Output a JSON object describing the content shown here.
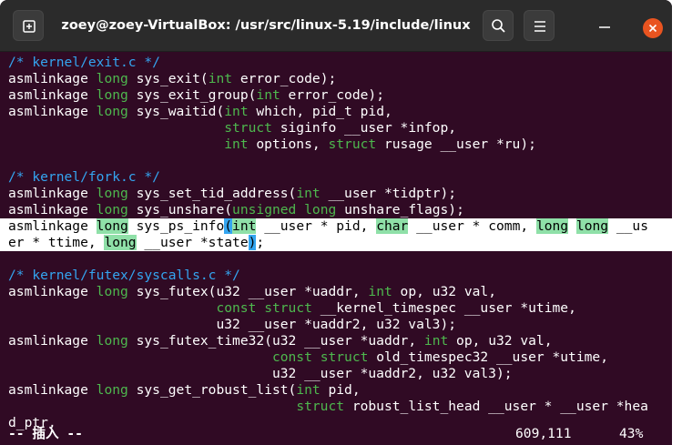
{
  "window": {
    "title": "zoey@zoey-VirtualBox: /usr/src/linux-5.19/include/linux",
    "accent": "#e95420",
    "background": "#300a24"
  },
  "lines": [
    [
      {
        "t": "/* kernel/exit.c */",
        "c": "c"
      }
    ],
    [
      {
        "t": "asmlinkage "
      },
      {
        "t": "long",
        "c": "k"
      },
      {
        "t": " sys_exit("
      },
      {
        "t": "int",
        "c": "k"
      },
      {
        "t": " error_code);"
      }
    ],
    [
      {
        "t": "asmlinkage "
      },
      {
        "t": "long",
        "c": "k"
      },
      {
        "t": " sys_exit_group("
      },
      {
        "t": "int",
        "c": "k"
      },
      {
        "t": " error_code);"
      }
    ],
    [
      {
        "t": "asmlinkage "
      },
      {
        "t": "long",
        "c": "k"
      },
      {
        "t": " sys_waitid("
      },
      {
        "t": "int",
        "c": "k"
      },
      {
        "t": " which, pid_t pid,"
      }
    ],
    [
      {
        "t": "                           "
      },
      {
        "t": "struct",
        "c": "k"
      },
      {
        "t": " siginfo __user *infop,"
      }
    ],
    [
      {
        "t": "                           "
      },
      {
        "t": "int",
        "c": "k"
      },
      {
        "t": " options, "
      },
      {
        "t": "struct",
        "c": "k"
      },
      {
        "t": " rusage __user *ru);"
      }
    ],
    [
      {
        "t": ""
      }
    ],
    [
      {
        "t": "/* kernel/fork.c */",
        "c": "c"
      }
    ],
    [
      {
        "t": "asmlinkage "
      },
      {
        "t": "long",
        "c": "k"
      },
      {
        "t": " sys_set_tid_address("
      },
      {
        "t": "int",
        "c": "k"
      },
      {
        "t": " __user *tidptr);"
      }
    ],
    [
      {
        "t": "asmlinkage "
      },
      {
        "t": "long",
        "c": "k"
      },
      {
        "t": " sys_unshare("
      },
      {
        "t": "unsigned",
        "c": "k"
      },
      {
        "t": " "
      },
      {
        "t": "long",
        "c": "k"
      },
      {
        "t": " unshare_flags);"
      }
    ],
    {
      "hl": true,
      "segs": [
        {
          "t": "asmlinkage "
        },
        {
          "t": "long",
          "c": "k"
        },
        {
          "t": " sys_ps_info"
        },
        {
          "t": "(",
          "c": "paren-hl"
        },
        {
          "t": "int",
          "c": "k"
        },
        {
          "t": " __user * pid, "
        },
        {
          "t": "char",
          "c": "k"
        },
        {
          "t": " __user * comm, "
        },
        {
          "t": "long",
          "c": "k"
        },
        {
          "t": " "
        },
        {
          "t": "long",
          "c": "k"
        },
        {
          "t": " __us"
        }
      ]
    },
    {
      "hl": true,
      "segs": [
        {
          "t": "er * ttime, "
        },
        {
          "t": "long",
          "c": "k"
        },
        {
          "t": " __user *state"
        },
        {
          "t": ")",
          "c": "paren-hl"
        },
        {
          "t": ";"
        }
      ]
    },
    [
      {
        "t": ""
      }
    ],
    [
      {
        "t": "/* kernel/futex/syscalls.c */",
        "c": "c"
      }
    ],
    [
      {
        "t": "asmlinkage "
      },
      {
        "t": "long",
        "c": "k"
      },
      {
        "t": " sys_futex(u32 __user *uaddr, "
      },
      {
        "t": "int",
        "c": "k"
      },
      {
        "t": " op, u32 val,"
      }
    ],
    [
      {
        "t": "                          "
      },
      {
        "t": "const",
        "c": "k"
      },
      {
        "t": " "
      },
      {
        "t": "struct",
        "c": "k"
      },
      {
        "t": " __kernel_timespec __user *utime,"
      }
    ],
    [
      {
        "t": "                          u32 __user *uaddr2, u32 val3);"
      }
    ],
    [
      {
        "t": "asmlinkage "
      },
      {
        "t": "long",
        "c": "k"
      },
      {
        "t": " sys_futex_time32(u32 __user *uaddr, "
      },
      {
        "t": "int",
        "c": "k"
      },
      {
        "t": " op, u32 val,"
      }
    ],
    [
      {
        "t": "                                 "
      },
      {
        "t": "const",
        "c": "k"
      },
      {
        "t": " "
      },
      {
        "t": "struct",
        "c": "k"
      },
      {
        "t": " old_timespec32 __user *utime,"
      }
    ],
    [
      {
        "t": "                                 u32 __user *uaddr2, u32 val3);"
      }
    ],
    [
      {
        "t": "asmlinkage "
      },
      {
        "t": "long",
        "c": "k"
      },
      {
        "t": " sys_get_robust_list("
      },
      {
        "t": "int",
        "c": "k"
      },
      {
        "t": " pid,"
      }
    ],
    [
      {
        "t": "                                    "
      },
      {
        "t": "struct",
        "c": "k"
      },
      {
        "t": " robust_list_head __user * __user *hea"
      }
    ],
    [
      {
        "t": "d_ptr,"
      }
    ]
  ],
  "status": {
    "mode": "-- 插入 --",
    "position": "609,111",
    "percent": "43%"
  },
  "icons": {
    "new_tab": "new-tab-icon",
    "search": "search-icon",
    "menu": "hamburger-menu-icon",
    "minimize": "minimize-icon",
    "close": "close-icon"
  }
}
